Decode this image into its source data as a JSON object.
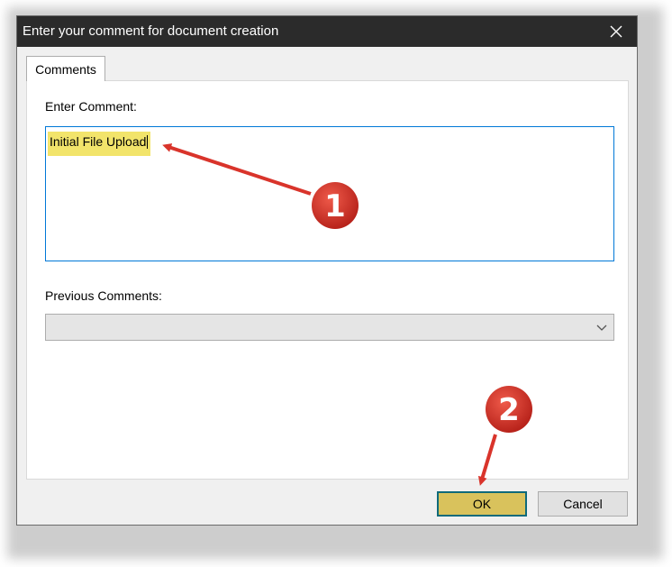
{
  "dialog": {
    "title": "Enter your comment for document creation",
    "close_icon": "close-icon"
  },
  "tabs": [
    {
      "label": "Comments",
      "selected": true
    }
  ],
  "comment": {
    "label": "Enter Comment:",
    "value": "Initial File Upload"
  },
  "previous_comments": {
    "label": "Previous Comments:",
    "selected_value": "",
    "icon": "chevron-down-icon"
  },
  "buttons": {
    "ok": "OK",
    "cancel": "Cancel"
  },
  "annotations": [
    {
      "number": "1",
      "color": "#d9342b"
    },
    {
      "number": "2",
      "color": "#d9342b"
    }
  ],
  "colors": {
    "titlebar": "#2b2b2b",
    "highlight": "#f2e46b",
    "focus_border": "#0078d7",
    "ok_button": "#d9c25c",
    "annotation": "#d9342b"
  }
}
